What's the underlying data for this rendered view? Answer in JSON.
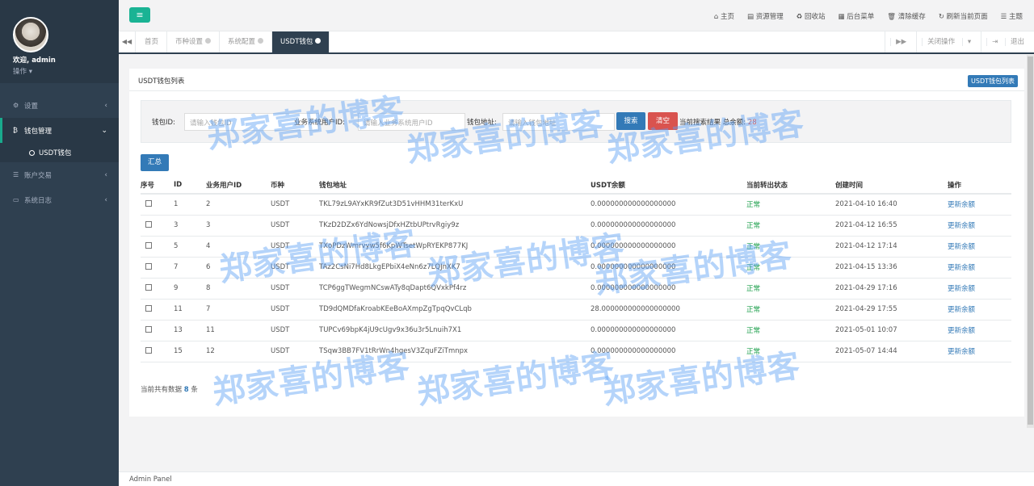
{
  "sidebar": {
    "welcome": "欢迎, admin",
    "operate": "操作",
    "items": [
      {
        "label": "设置",
        "icon": "gears-icon"
      },
      {
        "label": "钱包管理",
        "icon": "bitcoin-icon"
      },
      {
        "label": "账户交易",
        "icon": "list-icon"
      },
      {
        "label": "系统日志",
        "icon": "monitor-icon"
      }
    ],
    "sub_item": "USDT钱包"
  },
  "topbar": {
    "links": [
      "主页",
      "资源管理",
      "回收站",
      "后台菜单",
      "清除缓存",
      "刷新当前页面",
      "主题"
    ]
  },
  "tabs": {
    "items": [
      "首页",
      "币种设置",
      "系统配置",
      "USDT钱包"
    ],
    "close_ops": "关闭操作",
    "logout": "退出"
  },
  "panel": {
    "title": "USDT钱包列表",
    "badge": "USDT钱包列表"
  },
  "search": {
    "wallet_id_label": "钱包ID:",
    "wallet_id_placeholder": "请输入钱包ID",
    "user_id_label": "业务系统用户ID:",
    "user_id_placeholder": "请输入业务系统用户ID",
    "address_label": "钱包地址:",
    "address_placeholder": "请输入钱包地址",
    "search_btn": "搜索",
    "clear_btn": "清空",
    "stat_prefix": "当前搜索结果 总余额:",
    "stat_value": "28"
  },
  "summary_btn": "汇总",
  "table": {
    "headers": [
      "序号",
      "ID",
      "业务用户ID",
      "币种",
      "钱包地址",
      "USDT余额",
      "当前转出状态",
      "创建时间",
      "操作"
    ],
    "rows": [
      {
        "id": "1",
        "uid": "2",
        "coin": "USDT",
        "addr": "TKL79zL9AYxKR9fZut3D51vHHM31terKxU",
        "bal": "0.000000000000000000",
        "status": "正常",
        "time": "2021-04-10 16:40",
        "op": "更新余额"
      },
      {
        "id": "3",
        "uid": "3",
        "coin": "USDT",
        "addr": "TKzD2DZx6YdNowsjDfxHZtbUPtrvRgiy9z",
        "bal": "0.000000000000000000",
        "status": "正常",
        "time": "2021-04-12 16:55",
        "op": "更新余额"
      },
      {
        "id": "5",
        "uid": "4",
        "coin": "USDT",
        "addr": "TXoPDzWmrvyw5f6KpWTsetWpRYEKP877KJ",
        "bal": "0.000000000000000000",
        "status": "正常",
        "time": "2021-04-12 17:14",
        "op": "更新余额"
      },
      {
        "id": "7",
        "uid": "6",
        "coin": "USDT",
        "addr": "TAz2CsNi7Hd8LkgEPbiX4eNn6z7LQJnXK7",
        "bal": "0.000000000000000000",
        "status": "正常",
        "time": "2021-04-15 13:36",
        "op": "更新余额"
      },
      {
        "id": "9",
        "uid": "8",
        "coin": "USDT",
        "addr": "TCP6ggTWegmNCswATy8qDapt6QVxkPf4rz",
        "bal": "0.000000000000000000",
        "status": "正常",
        "time": "2021-04-29 17:16",
        "op": "更新余额"
      },
      {
        "id": "11",
        "uid": "7",
        "coin": "USDT",
        "addr": "TD9dQMDfaKroabKEeBoAXmpZgTpqQvCLqb",
        "bal": "28.000000000000000000",
        "status": "正常",
        "time": "2021-04-29 17:55",
        "op": "更新余额"
      },
      {
        "id": "13",
        "uid": "11",
        "coin": "USDT",
        "addr": "TUPCv69bpK4jU9cUgv9x36u3r5Lnuih7X1",
        "bal": "0.000000000000000000",
        "status": "正常",
        "time": "2021-05-01 10:07",
        "op": "更新余额"
      },
      {
        "id": "15",
        "uid": "12",
        "coin": "USDT",
        "addr": "TSqw3BB7FV1tRrWn4hgesV3ZquFZiTmnpx",
        "bal": "0.000000000000000000",
        "status": "正常",
        "time": "2021-05-07 14:44",
        "op": "更新余额"
      }
    ]
  },
  "count": {
    "prefix": "当前共有数据",
    "value": "8",
    "suffix": "条"
  },
  "footer": "Admin Panel",
  "watermark": "郑家喜的博客",
  "colors": {
    "sidebar": "#2f4050",
    "accent": "#1ab394",
    "primary": "#337ab7",
    "danger": "#d9534f",
    "ok": "#1a9e4a"
  }
}
